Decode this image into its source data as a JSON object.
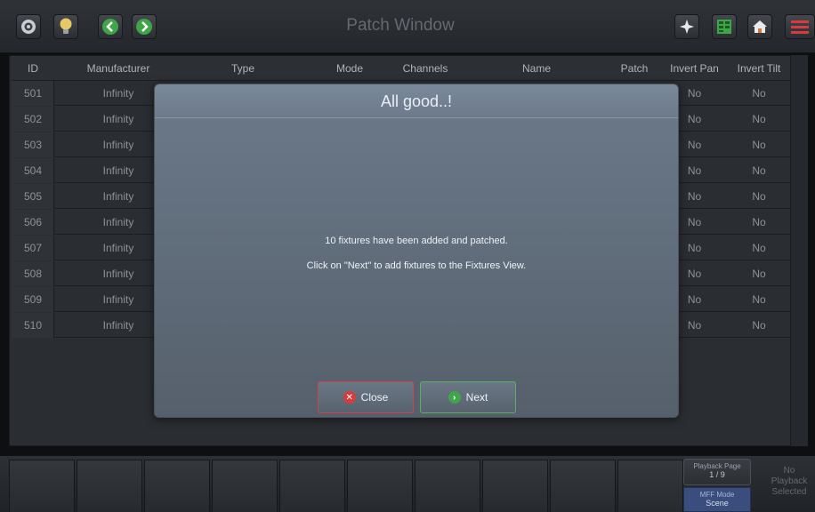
{
  "toolbar": {
    "title": "Patch Window",
    "icons": [
      "eye-icon",
      "lightbulb-icon",
      "back-arrow-icon",
      "forward-arrow-icon",
      "sparkle-icon",
      "grid-view-icon",
      "home-icon",
      "menu-icon"
    ]
  },
  "table": {
    "columns": [
      "ID",
      "Manufacturer",
      "Type",
      "Mode",
      "Channels",
      "Name",
      "Patch",
      "Invert Pan",
      "Invert Tilt"
    ],
    "rows": [
      {
        "id": "501",
        "manufacturer": "Infinity",
        "invert_pan": "No",
        "invert_tilt": "No"
      },
      {
        "id": "502",
        "manufacturer": "Infinity",
        "invert_pan": "No",
        "invert_tilt": "No"
      },
      {
        "id": "503",
        "manufacturer": "Infinity",
        "invert_pan": "No",
        "invert_tilt": "No"
      },
      {
        "id": "504",
        "manufacturer": "Infinity",
        "invert_pan": "No",
        "invert_tilt": "No"
      },
      {
        "id": "505",
        "manufacturer": "Infinity",
        "invert_pan": "No",
        "invert_tilt": "No"
      },
      {
        "id": "506",
        "manufacturer": "Infinity",
        "invert_pan": "No",
        "invert_tilt": "No"
      },
      {
        "id": "507",
        "manufacturer": "Infinity",
        "invert_pan": "No",
        "invert_tilt": "No"
      },
      {
        "id": "508",
        "manufacturer": "Infinity",
        "invert_pan": "No",
        "invert_tilt": "No"
      },
      {
        "id": "509",
        "manufacturer": "Infinity",
        "invert_pan": "No",
        "invert_tilt": "No"
      },
      {
        "id": "510",
        "manufacturer": "Infinity",
        "invert_pan": "No",
        "invert_tilt": "No"
      }
    ]
  },
  "modal": {
    "title": "All good..!",
    "message_line1": "10 fixtures have been added and patched.",
    "message_line2": "Click on \"Next\" to add fixtures to the Fixtures View.",
    "close_label": "Close",
    "next_label": "Next"
  },
  "bottom": {
    "playback_page_label": "Playback Page",
    "playback_page_value": "1 / 9",
    "mff_mode_label": "MFF Mode",
    "mff_mode_value": "Scene",
    "no_playback_line1": "No",
    "no_playback_line2": "Playback",
    "no_playback_line3": "Selected"
  },
  "colors": {
    "close_accent": "#d73c3c",
    "next_accent": "#3fa548",
    "mff_mode_bg": "#3a4e7e"
  }
}
